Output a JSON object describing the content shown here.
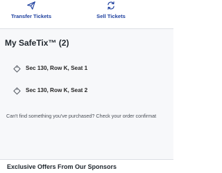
{
  "actions": {
    "transfer": {
      "label": "Transfer Tickets",
      "icon": "paper-plane-icon"
    },
    "sell": {
      "label": "Sell Tickets",
      "icon": "refresh-arrows-icon"
    }
  },
  "section": {
    "title": "My SafeTix™ (2)"
  },
  "tickets": [
    {
      "label": "Sec 130, Row K, Seat 1",
      "icon": "ticket-tag-icon"
    },
    {
      "label": "Sec 130, Row K, Seat 2",
      "icon": "ticket-tag-icon"
    }
  ],
  "help_text": "Can't find something you've purchased? Check your order confirmat",
  "sponsors": {
    "title": "Exclusive Offers From Our Sponsors"
  },
  "colors": {
    "accent": "#1d3f9e",
    "panel_background": "#f7f8fa",
    "text": "#1f262d"
  }
}
